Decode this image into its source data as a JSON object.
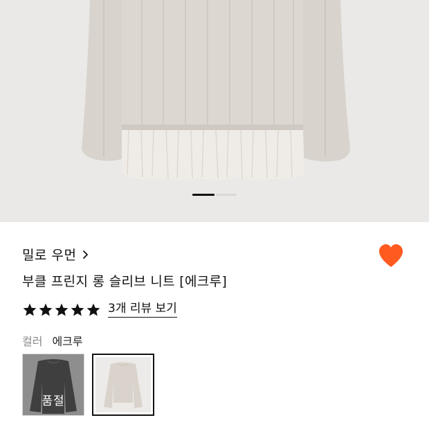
{
  "carousel": {
    "active_index": 1,
    "total": 2
  },
  "product": {
    "brand": "밀로 우먼",
    "title": "부클 프린지 롱 슬리브 니트 [에크루]",
    "rating_stars": 5,
    "reviews_link": "3개 리뷰 보기",
    "wishlist_active": true
  },
  "color_option": {
    "label": "컬러",
    "selected": "에크루",
    "swatches": [
      {
        "name": "charcoal",
        "sold_out": true,
        "sold_out_label": "품절"
      },
      {
        "name": "ecru",
        "sold_out": false,
        "selected": true
      }
    ]
  },
  "colors": {
    "accent": "#ff5a1f",
    "text": "#111111",
    "muted": "#8a8a8a",
    "hero_bg": "#eae9e7"
  },
  "icons": {
    "brand_chevron": "chevron-right-icon",
    "wishlist": "heart-icon",
    "star": "star-icon"
  }
}
